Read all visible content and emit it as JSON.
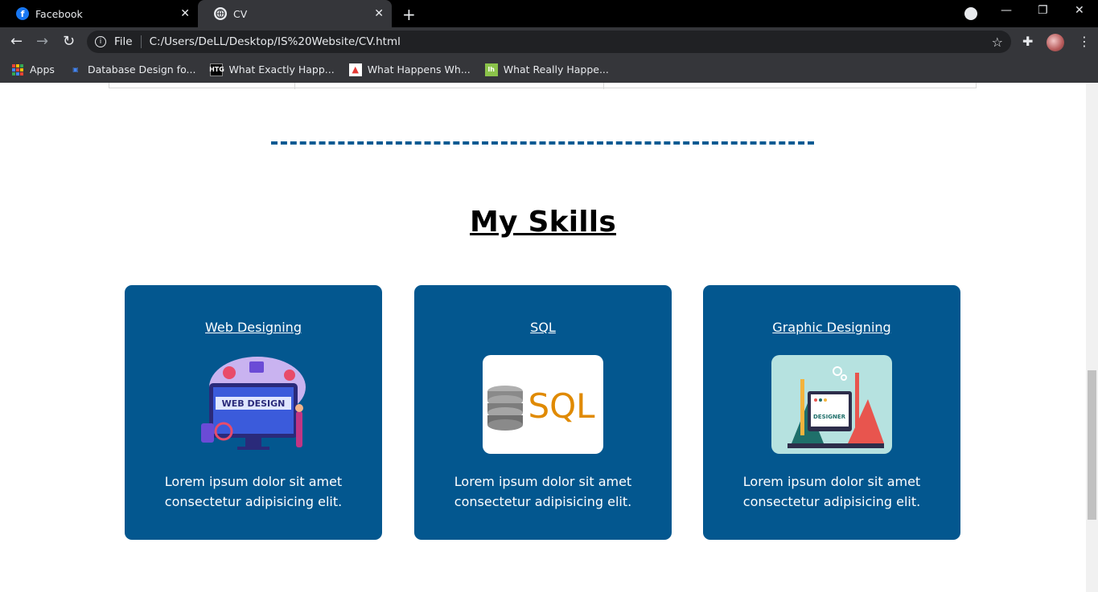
{
  "browser": {
    "tabs": [
      {
        "title": "Facebook",
        "icon": "facebook-icon"
      },
      {
        "title": "CV",
        "icon": "globe-icon"
      }
    ],
    "address": {
      "scheme_label": "File",
      "url": "C:/Users/DeLL/Desktop/IS%20Website/CV.html"
    },
    "bookmarks": [
      {
        "label": "Apps"
      },
      {
        "label": "Database Design fo..."
      },
      {
        "label": "What Exactly Happ...",
        "badge": "HTG"
      },
      {
        "label": "What Happens Wh..."
      },
      {
        "label": "What Really Happe...",
        "badge": "lh"
      }
    ]
  },
  "page": {
    "section_title": "My Skills",
    "skills": [
      {
        "title": "Web Designing",
        "image_text": "WEB DESIGN",
        "description": "Lorem ipsum dolor sit amet consectetur adipisicing elit."
      },
      {
        "title": "SQL",
        "image_text": "SQL",
        "description": "Lorem ipsum dolor sit amet consectetur adipisicing elit."
      },
      {
        "title": "Graphic Designing",
        "image_text": "DESIGNER",
        "description": "Lorem ipsum dolor sit amet consectetur adipisicing elit."
      }
    ]
  },
  "colors": {
    "card_bg": "#03578f",
    "divider": "#0b5a92",
    "chrome_dark": "#35363a"
  }
}
